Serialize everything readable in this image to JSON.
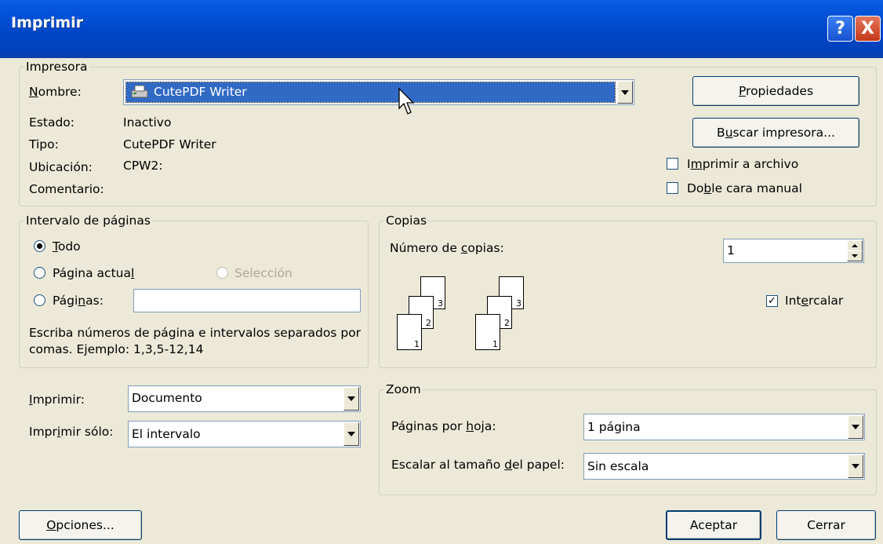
{
  "window": {
    "title": "Imprimir",
    "help_glyph": "?",
    "close_glyph": "X"
  },
  "printer": {
    "group_label": "Impresora",
    "name_label": "Nombre:",
    "name_value": "CutePDF Writer",
    "status_label": "Estado:",
    "status_value": "Inactivo",
    "type_label": "Tipo:",
    "type_value": "CutePDF Writer",
    "location_label": "Ubicación:",
    "location_value": "CPW2:",
    "comment_label": "Comentario:",
    "properties_button": "Propiedades",
    "find_printer_button": "Buscar impresora...",
    "print_to_file_label": "Imprimir a archivo",
    "print_to_file_checked": false,
    "manual_duplex_label": "Doble cara manual",
    "manual_duplex_checked": false,
    "selection_color": "#316AC5"
  },
  "page_range": {
    "group_label": "Intervalo de páginas",
    "all_label": "Todo",
    "current_label": "Página actual",
    "selection_label": "Selección",
    "pages_label": "Páginas:",
    "pages_value": "",
    "selected": "all",
    "hint": "Escriba números de página e intervalos separados por comas. Ejemplo: 1,3,5-12,14"
  },
  "copies": {
    "group_label": "Copias",
    "count_label": "Número de copias:",
    "count_value": "1",
    "collate_label": "Intercalar",
    "collate_checked": true,
    "page_numbers": [
      "3",
      "2",
      "1"
    ]
  },
  "print_what": {
    "print_label": "Imprimir:",
    "print_value": "Documento",
    "print_only_label": "Imprimir sólo:",
    "print_only_value": "El intervalo"
  },
  "zoom": {
    "group_label": "Zoom",
    "pages_per_sheet_label": "Páginas por hoja:",
    "pages_per_sheet_value": "1 página",
    "scale_label": "Escalar al tamaño del papel:",
    "scale_value": "Sin escala"
  },
  "footer": {
    "options_button": "Opciones...",
    "accept_button": "Aceptar",
    "close_button": "Cerrar"
  }
}
